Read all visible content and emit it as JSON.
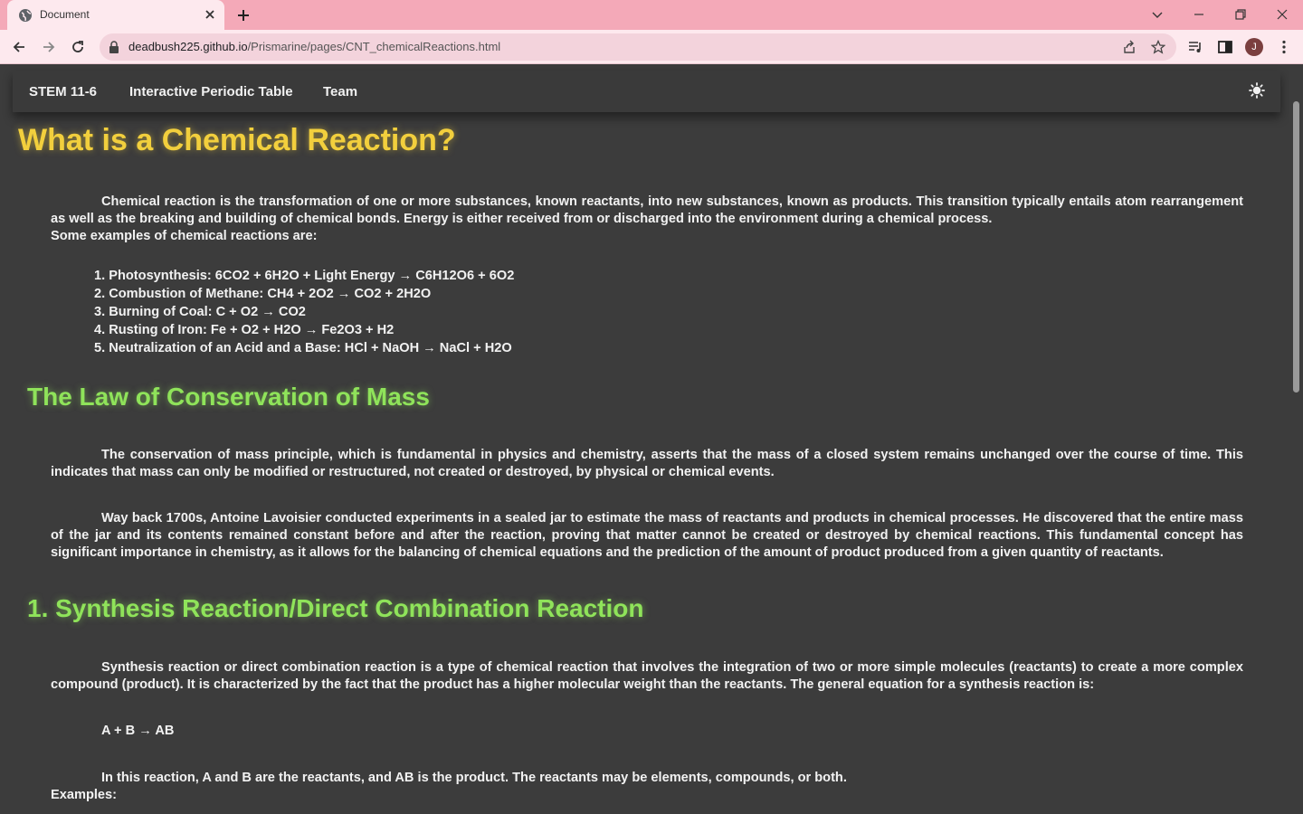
{
  "browser": {
    "tab_title": "Document",
    "url_host": "deadbush225.github.io",
    "url_path": "/Prismarine/pages/CNT_chemicalReactions.html",
    "profile_initial": "J"
  },
  "nav": {
    "brand": "STEM 11-6",
    "links": [
      "Interactive Periodic Table",
      "Team"
    ]
  },
  "content": {
    "title": "What is a Chemical Reaction?",
    "intro": "Chemical reaction is the transformation of one or more substances, known reactants, into new substances, known as products. This transition typically entails atom rearrangement as well as the breaking and building of chemical bonds. Energy is either received from or discharged into the environment during a chemical process.",
    "examples_intro": "Some examples of chemical reactions are:",
    "examples": [
      "1. Photosynthesis: 6CO2 + 6H2O + Light Energy → C6H12O6 + 6O2",
      "2. Combustion of Methane: CH4 + 2O2 → CO2 + 2H2O",
      "3. Burning of Coal: C + O2 → CO2",
      "4. Rusting of Iron: Fe + O2 + H2O → Fe2O3 + H2",
      "5. Neutralization of an Acid and a Base: HCl + NaOH → NaCl + H2O"
    ],
    "law_title": "The Law of Conservation of Mass",
    "law_p1": "The conservation of mass principle, which is fundamental in physics and chemistry, asserts that the mass of a closed system remains unchanged over the course of time. This indicates that mass can only be modified or restructured, not created or destroyed, by physical or chemical events.",
    "law_p2": "Way back 1700s, Antoine Lavoisier conducted experiments in a sealed jar to estimate the mass of reactants and products in chemical processes. He discovered that the entire mass of the jar and its contents remained constant before and after the reaction, proving that matter cannot be created or destroyed by chemical reactions. This fundamental concept has significant importance in chemistry, as it allows for the balancing of chemical equations and the prediction of the amount of product produced from a given quantity of reactants.",
    "synthesis_title": "1. Synthesis Reaction/Direct Combination Reaction",
    "synthesis_p1": "Synthesis reaction or direct combination reaction is a type of chemical reaction that involves the integration of two or more simple molecules (reactants) to create a more complex compound (product). It is characterized by the fact that the product has a higher molecular weight than the reactants. The general equation for a synthesis reaction is:",
    "synthesis_equation": "A + B → AB",
    "synthesis_p2": "In this reaction, A and B are the reactants, and AB is the product. The reactants may be elements, compounds, or both.",
    "examples_label": "Examples:"
  }
}
